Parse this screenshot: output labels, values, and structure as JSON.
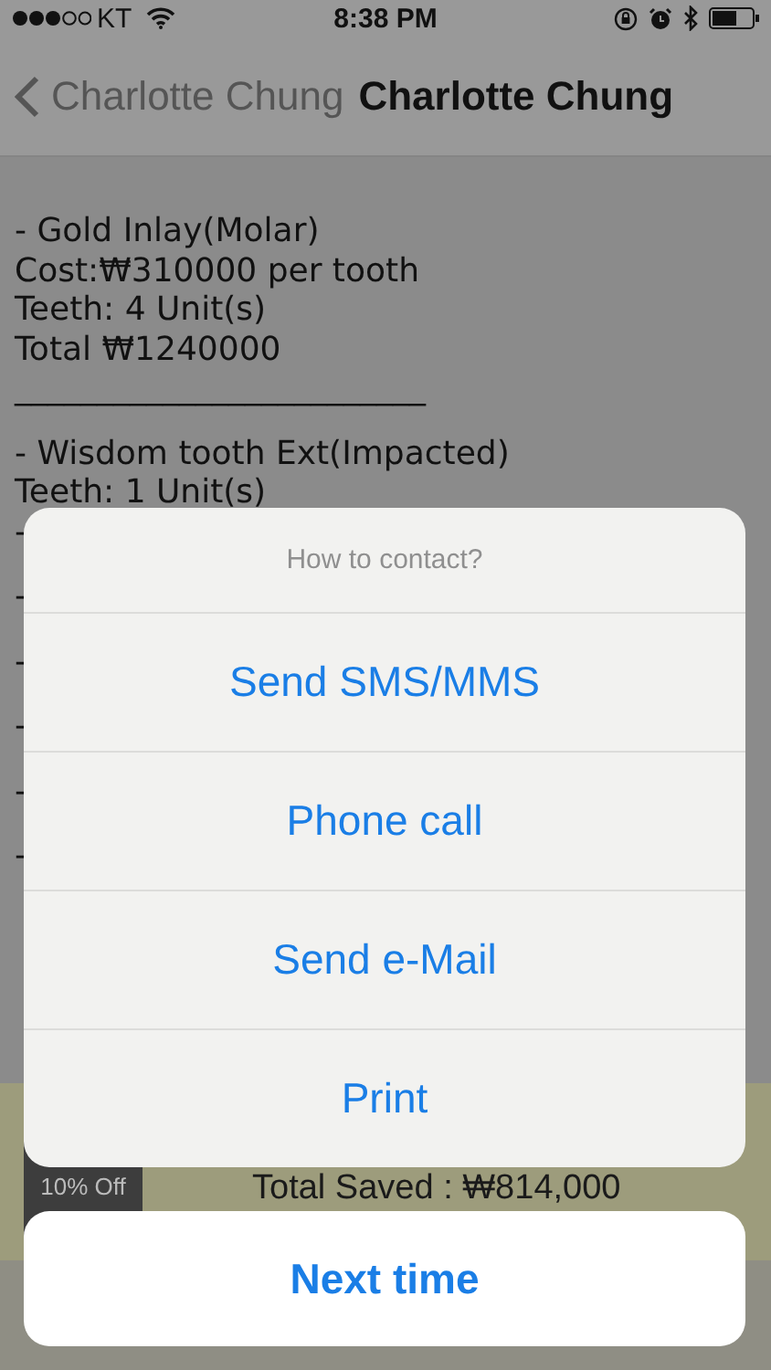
{
  "status_bar": {
    "carrier": "KT",
    "time": "8:38 PM"
  },
  "nav": {
    "back_label": "Charlotte Chung",
    "title": "Charlotte Chung"
  },
  "document": {
    "blocks": [
      [
        "- Gold Inlay(Molar)",
        "Cost:₩310000 per tooth",
        "Teeth: 4 Unit(s)",
        "Total ₩1240000",
        "_________________________"
      ],
      [
        "- Wisdom tooth Ext(Impacted)",
        "Teeth: 1 Unit(s)",
        "-"
      ],
      [
        "-"
      ],
      [
        "-"
      ],
      [
        "-"
      ],
      [
        "-"
      ],
      [
        "-"
      ]
    ]
  },
  "summary": {
    "badge": "10% Off",
    "total_saved": "Total Saved :  ₩814,000"
  },
  "action_sheet": {
    "title": "How to contact?",
    "actions": [
      "Send SMS/MMS",
      "Phone call",
      "Send e-Mail",
      "Print"
    ],
    "cancel": "Next time"
  }
}
